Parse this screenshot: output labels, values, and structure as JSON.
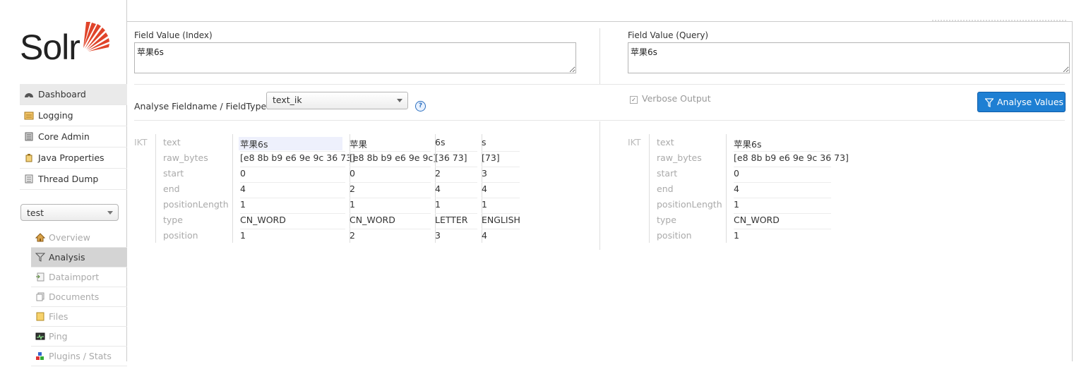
{
  "brand": {
    "logo_text": "Solr"
  },
  "nav": [
    {
      "label": "Dashboard",
      "icon": "dashboard-icon"
    },
    {
      "label": "Logging",
      "icon": "logging-icon"
    },
    {
      "label": "Core Admin",
      "icon": "core-admin-icon"
    },
    {
      "label": "Java Properties",
      "icon": "java-properties-icon"
    },
    {
      "label": "Thread Dump",
      "icon": "thread-dump-icon"
    }
  ],
  "core_selector": {
    "value": "test"
  },
  "core_menu": [
    {
      "label": "Overview",
      "icon": "home-icon"
    },
    {
      "label": "Analysis",
      "icon": "funnel-icon"
    },
    {
      "label": "Dataimport",
      "icon": "dataimport-icon"
    },
    {
      "label": "Documents",
      "icon": "documents-icon"
    },
    {
      "label": "Files",
      "icon": "files-icon"
    },
    {
      "label": "Ping",
      "icon": "ping-icon"
    },
    {
      "label": "Plugins / Stats",
      "icon": "plugins-icon"
    }
  ],
  "analysis": {
    "index_label": "Field Value (Index)",
    "index_value": "苹果6s",
    "query_label": "Field Value (Query)",
    "query_value": "苹果6s",
    "fieldtype_label": "Analyse Fieldname / FieldType:",
    "fieldtype_value": "text_ik",
    "verbose_label": "Verbose Output",
    "verbose_checked": true,
    "button_label": "Analyse Values"
  },
  "index_result": {
    "tokenizer": "IKT",
    "attributes": [
      "text",
      "raw_bytes",
      "start",
      "end",
      "positionLength",
      "type",
      "position"
    ],
    "tokens": [
      {
        "text": "苹果6s",
        "raw_bytes": "[e8 8b b9 e6 9e 9c 36 73]",
        "start": "0",
        "end": "4",
        "positionLength": "1",
        "type": "CN_WORD",
        "position": "1"
      },
      {
        "text": "苹果",
        "raw_bytes": "[e8 8b b9 e6 9e 9c]",
        "start": "0",
        "end": "2",
        "positionLength": "1",
        "type": "CN_WORD",
        "position": "2"
      },
      {
        "text": "6s",
        "raw_bytes": "[36 73]",
        "start": "2",
        "end": "4",
        "positionLength": "1",
        "type": "LETTER",
        "position": "3"
      },
      {
        "text": "s",
        "raw_bytes": "[73]",
        "start": "3",
        "end": "4",
        "positionLength": "1",
        "type": "ENGLISH",
        "position": "4"
      }
    ]
  },
  "query_result": {
    "tokenizer": "IKT",
    "attributes": [
      "text",
      "raw_bytes",
      "start",
      "end",
      "positionLength",
      "type",
      "position"
    ],
    "tokens": [
      {
        "text": "苹果6s",
        "raw_bytes": "[e8 8b b9 e6 9e 9c 36 73]",
        "start": "0",
        "end": "4",
        "positionLength": "1",
        "type": "CN_WORD",
        "position": "1"
      }
    ]
  },
  "colors": {
    "primary_button": "#1e7fd3",
    "logo_accent": "#e0442a"
  }
}
